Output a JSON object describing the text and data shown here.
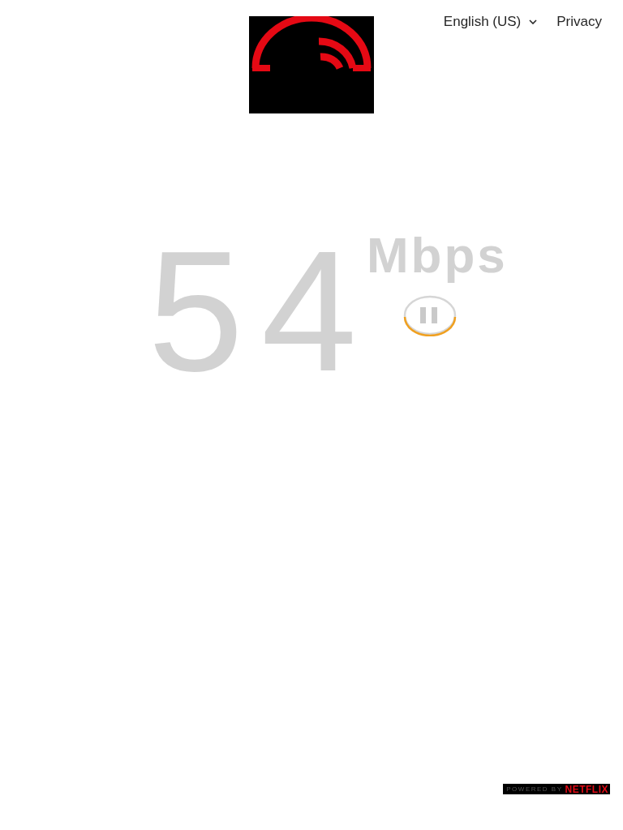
{
  "header": {
    "language": "English (US)",
    "privacy": "Privacy"
  },
  "speed": {
    "value": "54",
    "unit": "Mbps",
    "paused": false
  },
  "footer": {
    "powered_by": "POWERED BY",
    "brand": "NETFLIX"
  }
}
